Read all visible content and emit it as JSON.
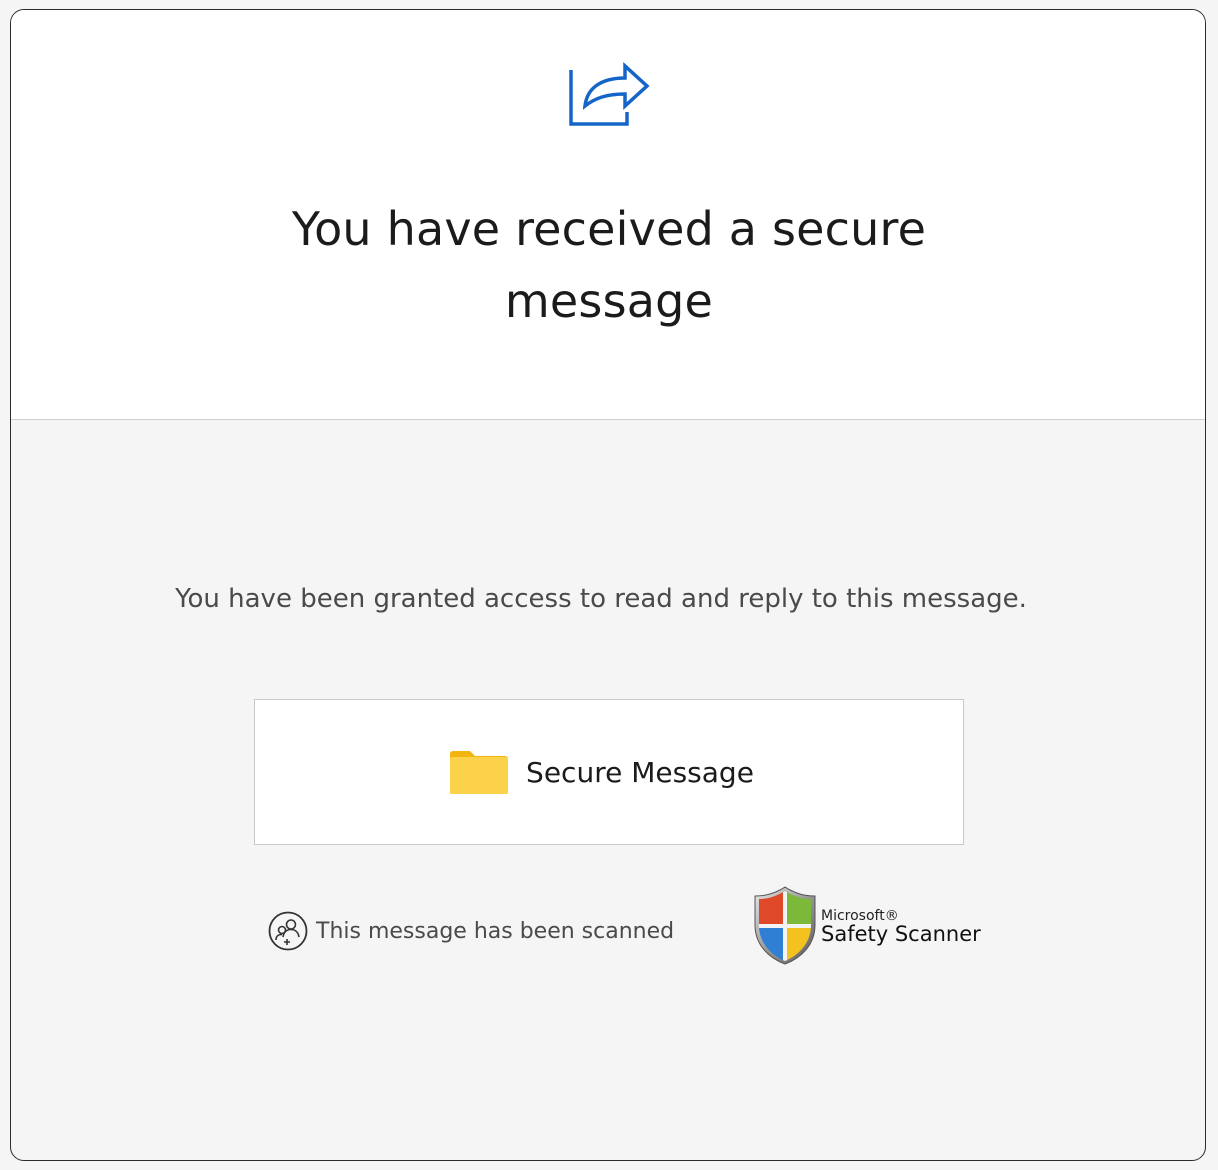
{
  "header": {
    "icon": "share-arrow-icon",
    "title": "You have received a secure message"
  },
  "body": {
    "description": "You have been granted access to read and reply to this message.",
    "button": {
      "icon": "folder-icon",
      "label": "Secure Message"
    },
    "scan_status": {
      "icon": "people-scan-icon",
      "text": "This message has been scanned"
    },
    "scanner_logo": {
      "icon": "shield-icon",
      "brand": "Microsoft®",
      "product": "Safety Scanner"
    }
  },
  "colors": {
    "accent": "#1565c8",
    "folder": "#fccf3e",
    "top_background": "#ffffff",
    "bottom_background": "#f5f5f5"
  }
}
